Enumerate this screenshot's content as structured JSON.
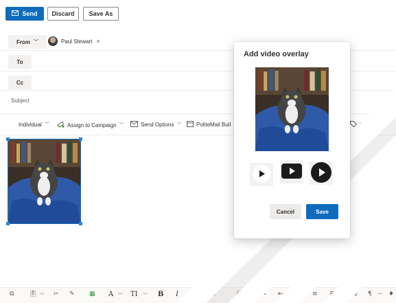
{
  "toolbar_top": {
    "send_label": "Send",
    "discard_label": "Discard",
    "save_as_label": "Save As"
  },
  "compose": {
    "from_label": "From",
    "from_name": "Paul Stewart",
    "to_label": "To",
    "cc_label": "Cc",
    "subject_placeholder": "Subject"
  },
  "ribbon": {
    "individual": "Individual",
    "assign_campaign": "Assign to Campaign",
    "send_options": "Send Options",
    "politemail": "PoliteMail Buil",
    "tagging": "Tagging"
  },
  "modal": {
    "title": "Add video overlay",
    "cancel_label": "Cancel",
    "save_label": "Save"
  },
  "colors": {
    "accent": "#0f6cbd",
    "modal_bg": "#ffffff"
  },
  "icons": [
    "send-icon",
    "chevron-down-icon",
    "close-icon",
    "assign-campaign-icon",
    "send-options-icon",
    "politemail-icon",
    "tag-icon",
    "play-icon",
    "copy-icon",
    "paste-icon",
    "cut-icon",
    "format-painter-icon",
    "highlight-icon",
    "font-icon",
    "font-size-icon",
    "bold-icon",
    "italic-icon",
    "underline-icon",
    "bullets-icon",
    "numbering-icon",
    "align-left-icon",
    "align-center-icon",
    "align-right-icon",
    "justify-icon",
    "paragraph-icon"
  ]
}
